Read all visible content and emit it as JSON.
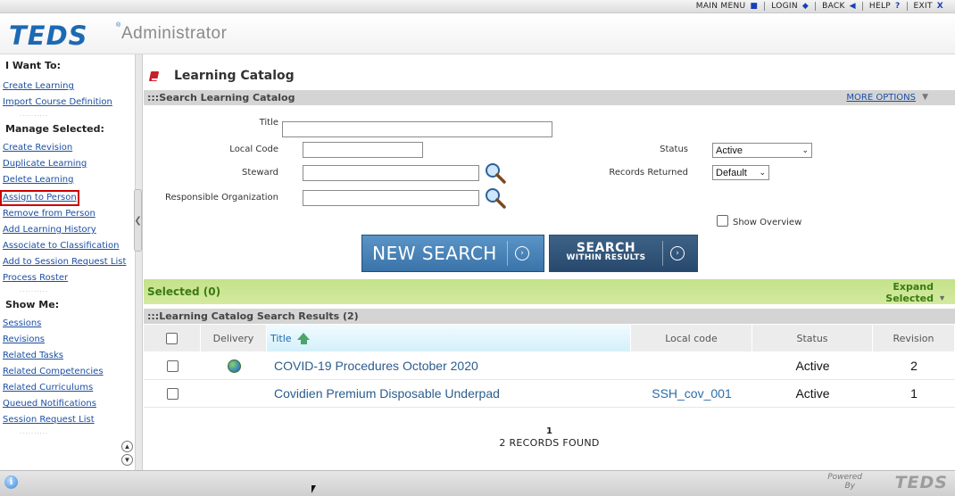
{
  "top_menu": [
    {
      "label": "MAIN MENU",
      "icon": "square-icon",
      "glyph": "■"
    },
    {
      "label": "LOGIN",
      "icon": "diamond-icon",
      "glyph": "◆"
    },
    {
      "label": "BACK",
      "icon": "back-triangle-icon",
      "glyph": "◀"
    },
    {
      "label": "HELP",
      "icon": "help-icon",
      "glyph": "?"
    },
    {
      "label": "EXIT",
      "icon": "close-icon",
      "glyph": "X"
    }
  ],
  "header": {
    "logo": "TEDS",
    "logo_mark": "®",
    "app_title": "Administrator"
  },
  "sidebar": {
    "i_want_to": {
      "heading": "I Want To:",
      "items": [
        "Create Learning",
        "Import Course Definition"
      ]
    },
    "manage_selected": {
      "heading": "Manage Selected:",
      "items": [
        "Create Revision",
        "Duplicate Learning",
        "Delete Learning",
        "Assign to Person",
        "Remove from Person",
        "Add Learning History",
        "Associate to Classification",
        "Add to Session Request List",
        "Process Roster"
      ],
      "highlighted": "Assign to Person"
    },
    "show_me": {
      "heading": "Show Me:",
      "items": [
        "Sessions",
        "Revisions",
        "Related Tasks",
        "Related Competencies",
        "Related Curriculums",
        "Queued Notifications",
        "Session Request List"
      ]
    },
    "dots": "..........",
    "collapse_glyph": "❮",
    "scroll_up": "▲",
    "scroll_down": "▼"
  },
  "main": {
    "page_title": "Learning Catalog",
    "search_section": {
      "title": ":::Search Learning Catalog",
      "more_options": "MORE OPTIONS",
      "more_arrow": "▼"
    },
    "fields": {
      "title_label": "Title",
      "title_value": "",
      "local_code_label": "Local Code",
      "local_code_value": "",
      "steward_label": "Steward",
      "steward_value": "",
      "resp_org_label": "Responsible Organization",
      "resp_org_value": "",
      "status_label": "Status",
      "status_value": "Active",
      "records_label": "Records Returned",
      "records_value": "Default",
      "show_overview_label": "Show Overview",
      "chevron": "⌄"
    },
    "buttons": {
      "new_search": "NEW SEARCH",
      "search_within_1": "SEARCH",
      "search_within_2": "WITHIN RESULTS",
      "go_glyph": "›"
    },
    "selected": {
      "label": "Selected (0)",
      "expand_1": "Expand",
      "expand_2": "Selected",
      "expand_arrow": "▼"
    },
    "results": {
      "title": ":::Learning Catalog Search Results (2)",
      "columns": [
        "Delivery",
        "Title",
        "Local code",
        "Status",
        "Revision"
      ],
      "rows": [
        {
          "title": "COVID-19 Procedures October 2020",
          "local_code": "",
          "status": "Active",
          "revision": "2"
        },
        {
          "title": "Covidien Premium Disposable Underpad",
          "local_code": "SSH_cov_001",
          "status": "Active",
          "revision": "1"
        }
      ]
    },
    "pager": {
      "page": "1",
      "records_found": "2 RECORDS FOUND"
    }
  },
  "footer": {
    "powered_1": "Powered",
    "powered_2": "By",
    "logo": "TEDS",
    "info_glyph": "i"
  }
}
